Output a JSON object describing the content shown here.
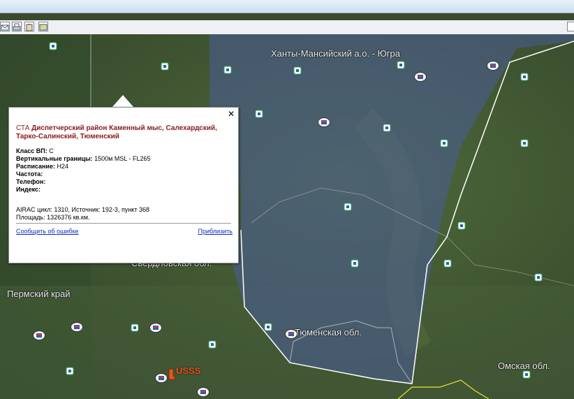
{
  "map": {
    "regions": [
      "Ханты-Мансийский а.о. - Югра",
      "Свердловская обл.",
      "Пермский край",
      "Тюменская обл.",
      "Омская обл."
    ],
    "pin_label": "USSS",
    "colors": {
      "zone_fill": "#4b5c9a",
      "zone_border": "#ffffff",
      "yellow_border": "#e6e62a",
      "pin": "#e8551b"
    }
  },
  "popup": {
    "close": "✕",
    "title_prefix": "СТА",
    "title_bold": "Диспетчерский район Каменный мыс, Салехардский, Тарко-Салинский, Тюменский",
    "class_label": "Класс ВП:",
    "class_value": "C",
    "vertical_label": "Вертикальные границы:",
    "vertical_value": "1500м MSL - FL265",
    "schedule_label": "Расписание:",
    "schedule_value": "H24",
    "freq_label": "Частота:",
    "freq_value": "",
    "phone_label": "Телефон:",
    "phone_value": "",
    "index_label": "Индекс:",
    "index_value": "",
    "airac": "AIRAC цикл: 1310, Источник: 192-3, пункт 368",
    "area": "Площадь: 1326376 кв.км.",
    "report_link": "Сообщить об ошибке",
    "zoom_link": "Приблизить"
  },
  "icons": [
    "envelope-icon",
    "print-icon",
    "clipboard-icon",
    "image-icon"
  ]
}
